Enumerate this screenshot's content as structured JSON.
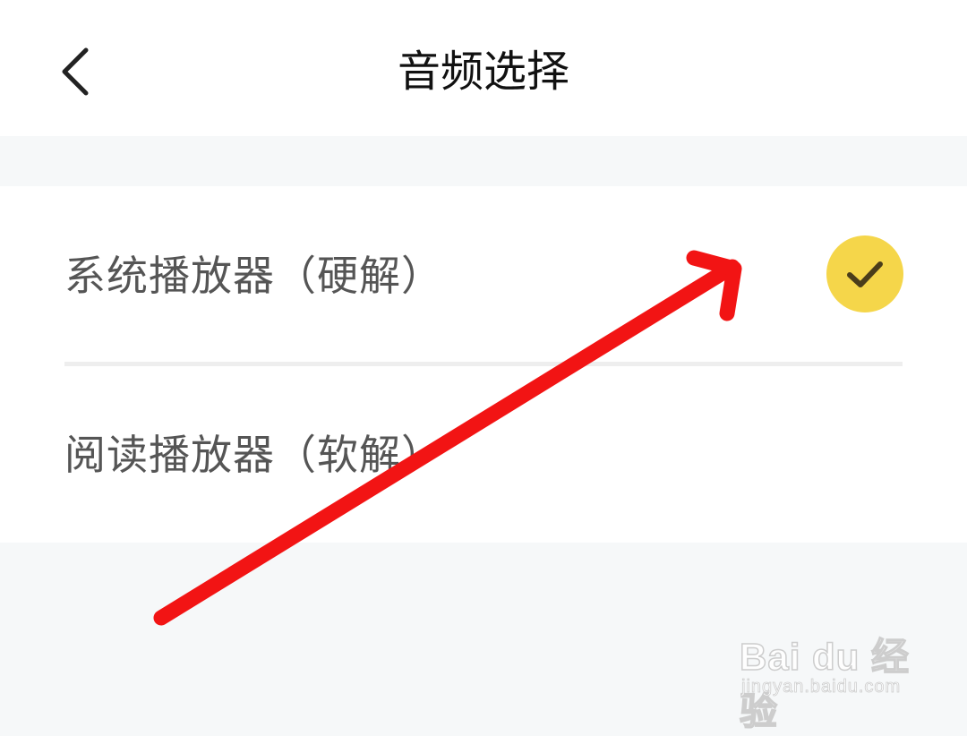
{
  "header": {
    "title": "音频选择",
    "back_icon": "chevron-left-icon"
  },
  "options": [
    {
      "label": "系统播放器（硬解）",
      "selected": true
    },
    {
      "label": "阅读播放器（软解）",
      "selected": false
    }
  ],
  "colors": {
    "accent": "#f5d64a",
    "annotation_arrow": "#f21414",
    "background": "#f6f8f9"
  },
  "watermark": {
    "brand": "Bai du 经验",
    "url": "jingyan.baidu.com"
  }
}
